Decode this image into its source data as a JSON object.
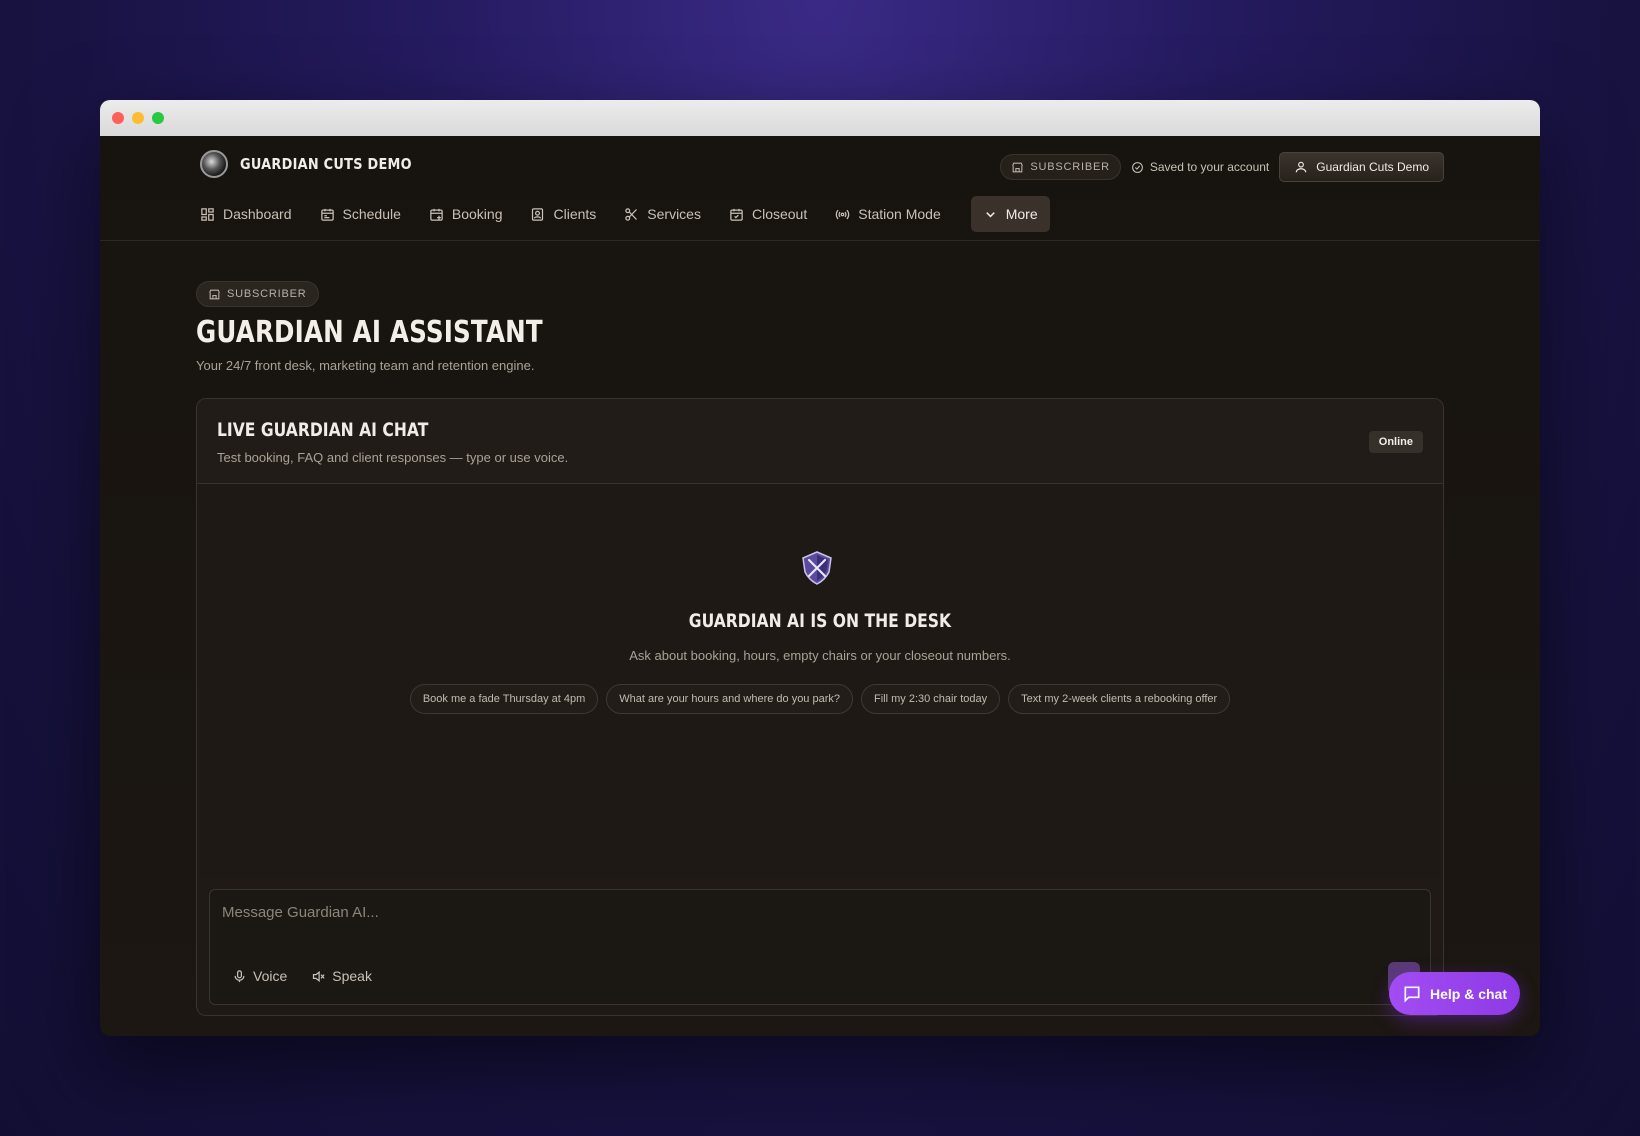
{
  "brand": {
    "name": "GUARDIAN CUTS DEMO"
  },
  "top_right": {
    "badge": "SUBSCRIBER",
    "saved": "Saved to your account",
    "account": "Guardian Cuts Demo"
  },
  "nav": {
    "items": [
      {
        "label": "Dashboard",
        "icon": "dashboard-icon"
      },
      {
        "label": "Schedule",
        "icon": "calendar-icon"
      },
      {
        "label": "Booking",
        "icon": "calendar-plus-icon"
      },
      {
        "label": "Clients",
        "icon": "contact-icon"
      },
      {
        "label": "Services",
        "icon": "scissors-icon"
      },
      {
        "label": "Closeout",
        "icon": "calendar-check-icon"
      },
      {
        "label": "Station Mode",
        "icon": "broadcast-icon"
      }
    ],
    "more": "More"
  },
  "page": {
    "badge": "SUBSCRIBER",
    "title": "GUARDIAN AI ASSISTANT",
    "subtitle": "Your 24/7 front desk, marketing team and retention engine."
  },
  "chat": {
    "title": "LIVE GUARDIAN AI CHAT",
    "subtitle": "Test booking, FAQ and client responses — type or use voice.",
    "status": "Online",
    "empty_title": "GUARDIAN AI IS ON THE DESK",
    "empty_sub": "Ask about booking, hours, empty chairs or your closeout numbers.",
    "suggestions": [
      "Book me a fade Thursday at 4pm",
      "What are your hours and where do you park?",
      "Fill my 2:30 chair today",
      "Text my 2-week clients a rebooking offer"
    ],
    "input_placeholder": "Message Guardian AI...",
    "voice": "Voice",
    "speak": "Speak"
  },
  "help": {
    "label": "Help & chat"
  },
  "colors": {
    "accent": "#9b47ef",
    "background": "#16120f"
  }
}
